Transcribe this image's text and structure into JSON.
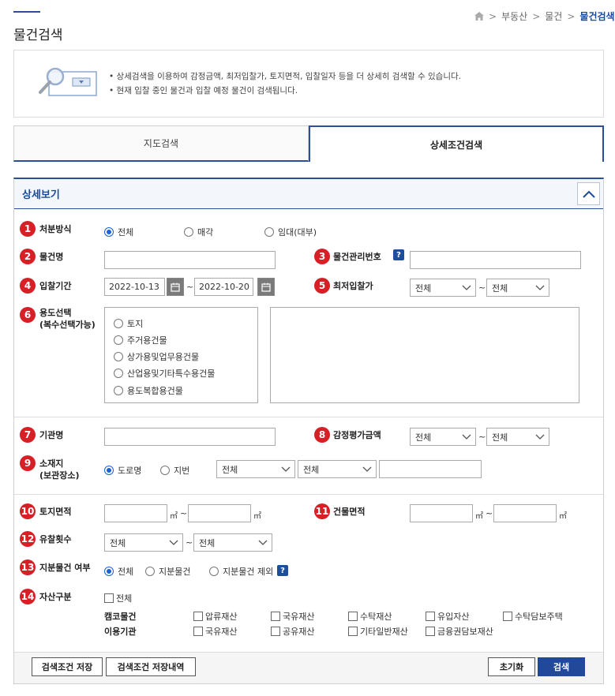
{
  "breadcrumb": {
    "items": [
      "부동산",
      "물건",
      "물건검색"
    ],
    "separator": ">"
  },
  "page": {
    "title": "물건검색"
  },
  "info": {
    "lines": [
      "• 상세검색을 이용하여 감정금액, 최저입찰가, 토지면적, 입찰일자 등을 더 상세히 검색할 수 있습니다.",
      "• 현재 입찰 중인 물건과 입찰 예정 물건이 검색됩니다."
    ]
  },
  "tabs": [
    {
      "label": "지도검색",
      "active": false
    },
    {
      "label": "상세조건검색",
      "active": true
    }
  ],
  "panel": {
    "title": "상세보기",
    "collapse_icon": "chevron-up-icon"
  },
  "markers": [
    "1",
    "2",
    "3",
    "4",
    "5",
    "6",
    "7",
    "8",
    "9",
    "10",
    "11",
    "12",
    "13",
    "14"
  ],
  "disposal": {
    "label": "처분방식",
    "options": [
      "전체",
      "매각",
      "임대(대부)"
    ],
    "selected": "전체"
  },
  "item_name": {
    "label": "물건명",
    "value": ""
  },
  "mgmt_no": {
    "label": "물건관리번호",
    "help": "?",
    "value": ""
  },
  "bid_period": {
    "label": "입찰기간",
    "from": "2022-10-13",
    "to": "2022-10-20",
    "tilde": "~"
  },
  "min_bid": {
    "label": "최저입찰가",
    "from": "전체",
    "to": "전체",
    "tilde": "~"
  },
  "usage": {
    "label": "용도선택",
    "label2": "(복수선택가능)",
    "options": [
      "토지",
      "주거용건물",
      "상가용및업무용건물",
      "산업용및기타특수용건물",
      "용도복합용건물"
    ]
  },
  "agency": {
    "label": "기관명",
    "value": ""
  },
  "appraisal": {
    "label": "감정평가금액",
    "from": "전체",
    "to": "전체",
    "tilde": "~"
  },
  "location": {
    "label": "소재지",
    "label2": "(보관장소)",
    "options": [
      "도로명",
      "지번"
    ],
    "selected": "도로명",
    "sido": "전체",
    "sigungu": "전체",
    "detail": ""
  },
  "land_area": {
    "label": "토지면적",
    "unit": "㎡",
    "tilde": "~"
  },
  "building_area": {
    "label": "건물면적",
    "unit": "㎡",
    "tilde": "~"
  },
  "fail_count": {
    "label": "유찰횟수",
    "from": "전체",
    "to": "전체",
    "tilde": "~"
  },
  "share": {
    "label": "지분물건 여부",
    "options": [
      "전체",
      "지분물건",
      "지분물건 제외"
    ],
    "selected": "전체",
    "help": "?"
  },
  "asset": {
    "label": "자산구분",
    "all": "전체",
    "camco_label": "캠코물건",
    "camco": [
      "압류재산",
      "국유재산",
      "수탁재산",
      "유입자산",
      "수탁담보주택"
    ],
    "agency_label": "이용기관",
    "agency_items": [
      "국유재산",
      "공유재산",
      "기타일반재산",
      "금융권담보재산"
    ]
  },
  "buttons": {
    "save": "검색조건 저장",
    "history": "검색조건 저장내역",
    "reset": "초기화",
    "search": "검색"
  },
  "colors": {
    "accent": "#2a4f9a",
    "marker": "#d71f26",
    "primary_button": "#22489a"
  }
}
